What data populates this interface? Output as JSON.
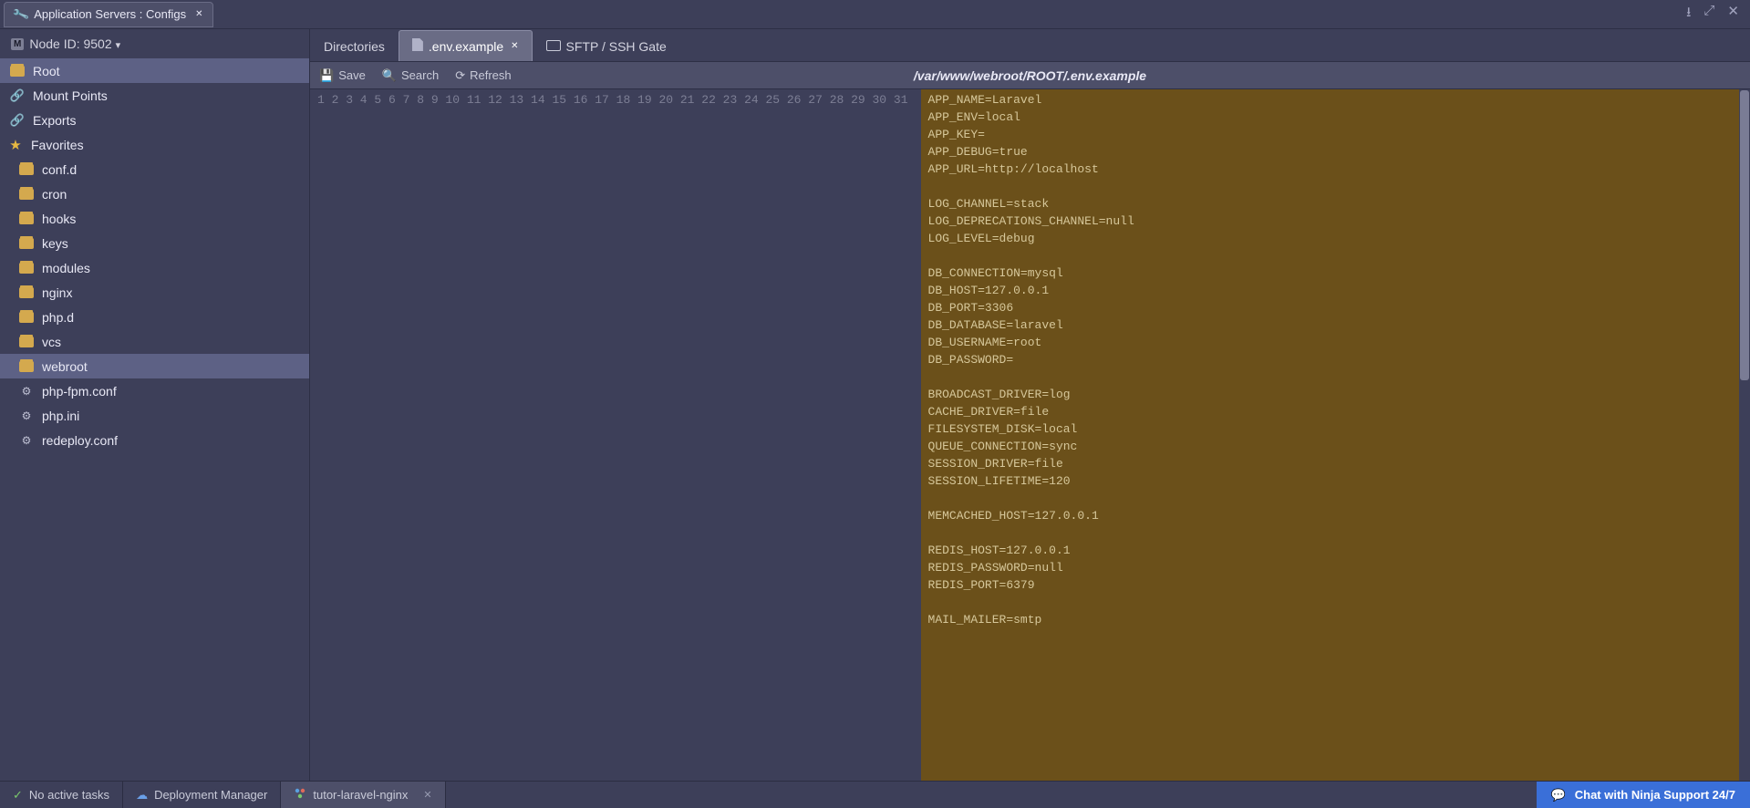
{
  "top": {
    "tab_title": "Application Servers : Configs",
    "window_controls": {
      "download": "⭳",
      "fullscreen": "⤢",
      "close": "✕"
    }
  },
  "sidebar": {
    "node_label": "Node ID: 9502",
    "items": [
      {
        "label": "Root",
        "type": "folder",
        "selected": true,
        "level": 0
      },
      {
        "label": "Mount Points",
        "type": "chain",
        "level": 0
      },
      {
        "label": "Exports",
        "type": "chain",
        "level": 0
      },
      {
        "label": "Favorites",
        "type": "star",
        "level": -1
      },
      {
        "label": "conf.d",
        "type": "folder",
        "level": 1
      },
      {
        "label": "cron",
        "type": "folder",
        "level": 1
      },
      {
        "label": "hooks",
        "type": "folder",
        "level": 1
      },
      {
        "label": "keys",
        "type": "folder",
        "level": 1
      },
      {
        "label": "modules",
        "type": "folder",
        "level": 1
      },
      {
        "label": "nginx",
        "type": "folder",
        "level": 1
      },
      {
        "label": "php.d",
        "type": "folder",
        "level": 1
      },
      {
        "label": "vcs",
        "type": "folder",
        "level": 1
      },
      {
        "label": "webroot",
        "type": "folder",
        "level": 1,
        "selected": true
      },
      {
        "label": "php-fpm.conf",
        "type": "gear",
        "level": 1
      },
      {
        "label": "php.ini",
        "type": "gear",
        "level": 1
      },
      {
        "label": "redeploy.conf",
        "type": "gear",
        "level": 1
      }
    ]
  },
  "tabs": [
    {
      "label": "Directories",
      "icon": "none",
      "active": false,
      "closable": false
    },
    {
      "label": ".env.example",
      "icon": "file",
      "active": true,
      "closable": true
    },
    {
      "label": "SFTP / SSH Gate",
      "icon": "monitor",
      "active": false,
      "closable": false
    }
  ],
  "toolbar": {
    "save": "Save",
    "search": "Search",
    "refresh": "Refresh",
    "path": "/var/www/webroot/ROOT/.env.example"
  },
  "code": [
    "APP_NAME=Laravel",
    "APP_ENV=local",
    "APP_KEY=",
    "APP_DEBUG=true",
    "APP_URL=http://localhost",
    "",
    "LOG_CHANNEL=stack",
    "LOG_DEPRECATIONS_CHANNEL=null",
    "LOG_LEVEL=debug",
    "",
    "DB_CONNECTION=mysql",
    "DB_HOST=127.0.0.1",
    "DB_PORT=3306",
    "DB_DATABASE=laravel",
    "DB_USERNAME=root",
    "DB_PASSWORD=",
    "",
    "BROADCAST_DRIVER=log",
    "CACHE_DRIVER=file",
    "FILESYSTEM_DISK=local",
    "QUEUE_CONNECTION=sync",
    "SESSION_DRIVER=file",
    "SESSION_LIFETIME=120",
    "",
    "MEMCACHED_HOST=127.0.0.1",
    "",
    "REDIS_HOST=127.0.0.1",
    "REDIS_PASSWORD=null",
    "REDIS_PORT=6379",
    "",
    "MAIL_MAILER=smtp"
  ],
  "bottom": {
    "tasks": "No active tasks",
    "deploy": "Deployment Manager",
    "tab": "tutor-laravel-nginx",
    "chat": "Chat with Ninja Support 24/7"
  }
}
